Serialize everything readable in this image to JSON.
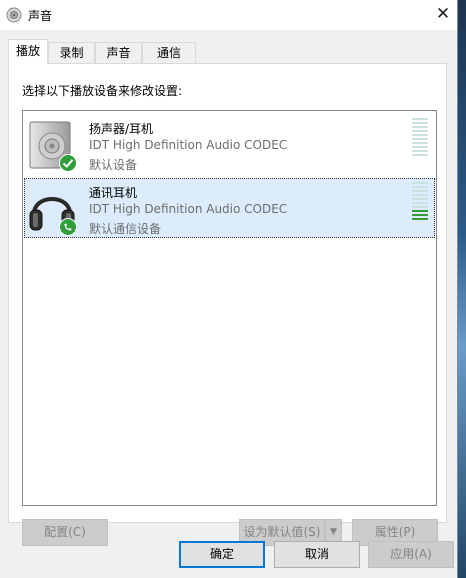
{
  "window": {
    "title": "声音",
    "close_glyph": "✕"
  },
  "tabs": [
    {
      "label": "播放",
      "active": true
    },
    {
      "label": "录制",
      "active": false
    },
    {
      "label": "声音",
      "active": false
    },
    {
      "label": "通信",
      "active": false
    }
  ],
  "panel": {
    "prompt": "选择以下播放设备来修改设置:"
  },
  "devices": [
    {
      "name": "扬声器/耳机",
      "driver": "IDT High Definition Audio CODEC",
      "status": "默认设备",
      "icon": "speaker-icon",
      "badge": "default-check-icon",
      "level": 0
    },
    {
      "name": "通讯耳机",
      "driver": "IDT High Definition Audio CODEC",
      "status": "默认通信设备",
      "icon": "headphones-icon",
      "badge": "phone-badge-icon",
      "level": 0.3
    }
  ],
  "buttons": {
    "configure": "配置(C)",
    "set_default": "设为默认值(S)",
    "properties": "属性(P)",
    "ok": "确定",
    "cancel": "取消",
    "apply": "应用(A)"
  },
  "colors": {
    "accent": "#0078d7",
    "meter_on": "#3a9a3a",
    "meter_off": "#c9dfe0",
    "selected": "#dcecfc"
  }
}
